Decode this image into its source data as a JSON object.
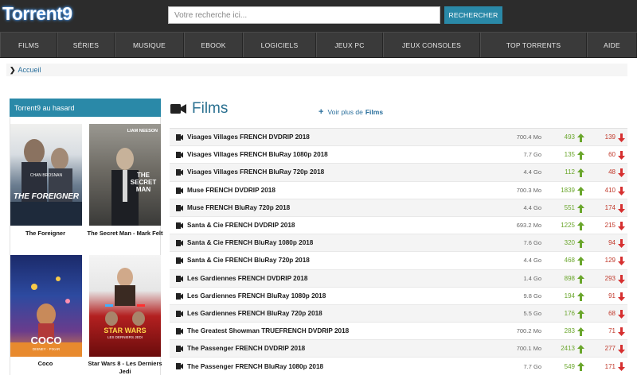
{
  "header": {
    "logo": "Torrent9",
    "search_placeholder": "Votre recherche ici...",
    "search_button": "RECHERCHER"
  },
  "nav": [
    {
      "label": "FILMS"
    },
    {
      "label": "SÉRIES"
    },
    {
      "label": "MUSIQUE"
    },
    {
      "label": "EBOOK"
    },
    {
      "label": "LOGICIELS"
    },
    {
      "label": "JEUX PC"
    },
    {
      "label": "JEUX CONSOLES"
    },
    {
      "label": "TOP TORRENTS"
    },
    {
      "label": "AIDE"
    }
  ],
  "breadcrumb": {
    "home": "Accueil"
  },
  "sidebar": {
    "title": "Torrent9 au hasard",
    "items": [
      {
        "caption": "The Foreigner",
        "poster_title": "THE FOREIGNER",
        "poster_sub": "CHAN  BROSNAN"
      },
      {
        "caption": "The Secret Man - Mark Felt",
        "poster_title": "THE SECRET MAN",
        "poster_sub": "LIAM NEESON"
      },
      {
        "caption": "Coco",
        "poster_title": "COCO",
        "poster_sub": "DISNEY · PIXAR"
      },
      {
        "caption": "Star Wars 8 - Les Derniers Jedi",
        "poster_title": "STAR WARS",
        "poster_sub": "LES DERNIERS JEDI"
      }
    ]
  },
  "main": {
    "section_title": "Films",
    "more_prefix": "Voir plus de",
    "more_strong": "Films",
    "icons": {
      "camera": "camera-icon",
      "up": "arrow-up-icon",
      "down": "arrow-down-icon"
    },
    "colors": {
      "accent": "#2a89a8",
      "seed": "#6aa62c",
      "leech": "#c0392b"
    },
    "rows": [
      {
        "title": "Visages Villages FRENCH DVDRIP 2018",
        "size": "700.4 Mo",
        "seeders": "493",
        "leechers": "139"
      },
      {
        "title": "Visages Villages FRENCH BluRay 1080p 2018",
        "size": "7.7 Go",
        "seeders": "135",
        "leechers": "60"
      },
      {
        "title": "Visages Villages FRENCH BluRay 720p 2018",
        "size": "4.4 Go",
        "seeders": "112",
        "leechers": "48"
      },
      {
        "title": "Muse FRENCH DVDRIP 2018",
        "size": "700.3 Mo",
        "seeders": "1839",
        "leechers": "410"
      },
      {
        "title": "Muse FRENCH BluRay 720p 2018",
        "size": "4.4 Go",
        "seeders": "551",
        "leechers": "174"
      },
      {
        "title": "Santa & Cie FRENCH DVDRIP 2018",
        "size": "693.2 Mo",
        "seeders": "1225",
        "leechers": "215"
      },
      {
        "title": "Santa & Cie FRENCH BluRay 1080p 2018",
        "size": "7.6 Go",
        "seeders": "320",
        "leechers": "94"
      },
      {
        "title": "Santa & Cie FRENCH BluRay 720p 2018",
        "size": "4.4 Go",
        "seeders": "468",
        "leechers": "129"
      },
      {
        "title": "Les Gardiennes FRENCH DVDRIP 2018",
        "size": "1.4 Go",
        "seeders": "898",
        "leechers": "293"
      },
      {
        "title": "Les Gardiennes FRENCH BluRay 1080p 2018",
        "size": "9.8 Go",
        "seeders": "194",
        "leechers": "91"
      },
      {
        "title": "Les Gardiennes FRENCH BluRay 720p 2018",
        "size": "5.5 Go",
        "seeders": "176",
        "leechers": "68"
      },
      {
        "title": "The Greatest Showman TRUEFRENCH DVDRIP 2018",
        "size": "700.2 Mo",
        "seeders": "283",
        "leechers": "71"
      },
      {
        "title": "The Passenger FRENCH DVDRIP 2018",
        "size": "700.1 Mo",
        "seeders": "2413",
        "leechers": "277"
      },
      {
        "title": "The Passenger FRENCH BluRay 1080p 2018",
        "size": "7.7 Go",
        "seeders": "549",
        "leechers": "171"
      }
    ]
  }
}
